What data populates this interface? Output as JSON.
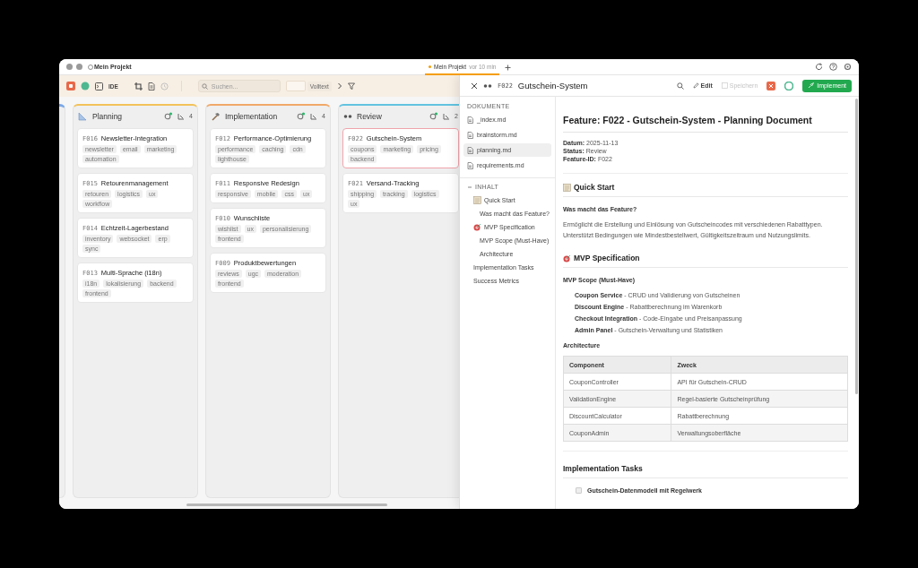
{
  "window": {
    "title": "Mein Projekt"
  },
  "tabs": [
    {
      "label": "Mein Projekt",
      "badge": "vor 10 min",
      "selected": true
    }
  ],
  "toolbar": {
    "ide_label": "IDE",
    "mode_toggle": {
      "selected": false
    },
    "search": {
      "placeholder": "Suchen..."
    },
    "fulltext_label": "Volltext"
  },
  "columns": [
    {
      "kind": "stub",
      "color": "#7aa7e6"
    },
    {
      "kind": "full",
      "name": "Planning",
      "count": "4",
      "color": "#f2c25a",
      "cards": [
        {
          "id": "F016",
          "title": "Newsletter-Integration",
          "selected": false,
          "tags": [
            "newsletter",
            "email",
            "marketing",
            "automation"
          ]
        },
        {
          "id": "F015",
          "title": "Retourenmanagement",
          "selected": false,
          "tags": [
            "retouren",
            "logistics",
            "ux",
            "workflow"
          ]
        },
        {
          "id": "F014",
          "title": "Echtzeit-Lagerbestand",
          "selected": false,
          "tags": [
            "inventory",
            "websocket",
            "erp",
            "sync"
          ]
        },
        {
          "id": "F013",
          "title": "Multi-Sprache (i18n)",
          "selected": false,
          "tags": [
            "i18n",
            "lokalisierung",
            "backend",
            "frontend"
          ]
        }
      ]
    },
    {
      "kind": "full",
      "name": "Implementation",
      "count": "4",
      "color": "#f0a868",
      "cards": [
        {
          "id": "F012",
          "title": "Performance-Optimierung",
          "selected": false,
          "tags": [
            "performance",
            "caching",
            "cdn",
            "lighthouse"
          ]
        },
        {
          "id": "F011",
          "title": "Responsive Redesign",
          "selected": false,
          "tags": [
            "responsive",
            "mobile",
            "css",
            "ux"
          ]
        },
        {
          "id": "F010",
          "title": "Wunschliste",
          "selected": false,
          "tags": [
            "wishlist",
            "ux",
            "personalisierung",
            "frontend"
          ]
        },
        {
          "id": "F009",
          "title": "Produktbewertungen",
          "selected": false,
          "tags": [
            "reviews",
            "ugc",
            "moderation",
            "frontend"
          ]
        }
      ]
    },
    {
      "kind": "full",
      "name": "Review",
      "count": "2",
      "color": "#62c3e0",
      "cards": [
        {
          "id": "F022",
          "title": "Gutschein-System",
          "selected": true,
          "tags": [
            "coupons",
            "marketing",
            "pricing",
            "backend"
          ]
        },
        {
          "id": "F021",
          "title": "Versand-Tracking",
          "selected": false,
          "tags": [
            "shipping",
            "tracking",
            "logistics",
            "ux"
          ]
        }
      ]
    }
  ],
  "detail": {
    "id": "F022",
    "title": "Gutschein-System",
    "edit_label": "Edit",
    "save": {
      "label": "Speichern",
      "disabled": true
    },
    "implement_label": "Implement"
  },
  "docs": {
    "heading": "DOKUMENTE",
    "files": [
      {
        "name": "_index.md",
        "selected": false
      },
      {
        "name": "brainstorm.md",
        "selected": false
      },
      {
        "name": "planning.md",
        "selected": true
      },
      {
        "name": "requirements.md",
        "selected": false
      }
    ]
  },
  "toc": {
    "heading": "INHALT",
    "expanded": true,
    "items": [
      {
        "label": "Quick Start",
        "children": [
          {
            "label": "Was macht das Feature?"
          }
        ]
      },
      {
        "label": "MVP Specification",
        "children": [
          {
            "label": "MVP Scope (Must-Have)"
          },
          {
            "label": "Architecture"
          }
        ]
      },
      {
        "label": "Implementation Tasks"
      },
      {
        "label": "Success Metrics"
      }
    ]
  },
  "document": {
    "blocks": [
      {
        "kind": "h1",
        "text": "Feature: F022 - Gutschein-System - Planning Document"
      },
      {
        "kind": "meta",
        "items": [
          {
            "key": "Datum:",
            "value": "2025-11-13"
          },
          {
            "key": "Status:",
            "value": "Review"
          },
          {
            "key": "Feature-ID:",
            "value": "F022"
          }
        ]
      },
      {
        "kind": "h2",
        "text": "Quick Start"
      },
      {
        "kind": "h3",
        "text": "Was macht das Feature?"
      },
      {
        "kind": "p",
        "lines": [
          "Ermöglicht die Erstellung und Einlösung von Gutscheincodes mit verschiedenen Rabatttypen.",
          "Unterstützt Bedingungen wie Mindestbestellwert, Gültigkeitszeitraum und Nutzungslimits."
        ]
      },
      {
        "kind": "h2",
        "text": "MVP Specification"
      },
      {
        "kind": "h3",
        "text": "MVP Scope (Must-Have)"
      },
      {
        "kind": "list",
        "items": [
          "**Coupon Service** - CRUD und Validierung von Gutscheinen",
          "**Discount Engine** - Rabattberechnung im Warenkorb",
          "**Checkout Integration** - Code-Eingabe und Preisanpassung",
          "**Admin Panel** - Gutschein-Verwaltung und Statistiken"
        ]
      },
      {
        "kind": "h3",
        "text": "Architecture"
      },
      {
        "kind": "table",
        "columns": [
          "Component",
          "Zweck"
        ],
        "rows": [
          [
            "CouponController",
            "API für Gutschein-CRUD"
          ],
          [
            "ValidationEngine",
            "Regel-basierte Gutscheinprüfung"
          ],
          [
            "DiscountCalculator",
            "Rabattberechnung"
          ],
          [
            "CouponAdmin",
            "Verwaltungsoberfläche"
          ]
        ]
      },
      {
        "kind": "h2",
        "text": "Implementation Tasks"
      },
      {
        "kind": "tasks",
        "items": [
          {
            "label": "Gutschein-Datenmodell mit Regelwerk",
            "checked": false
          }
        ]
      }
    ]
  }
}
